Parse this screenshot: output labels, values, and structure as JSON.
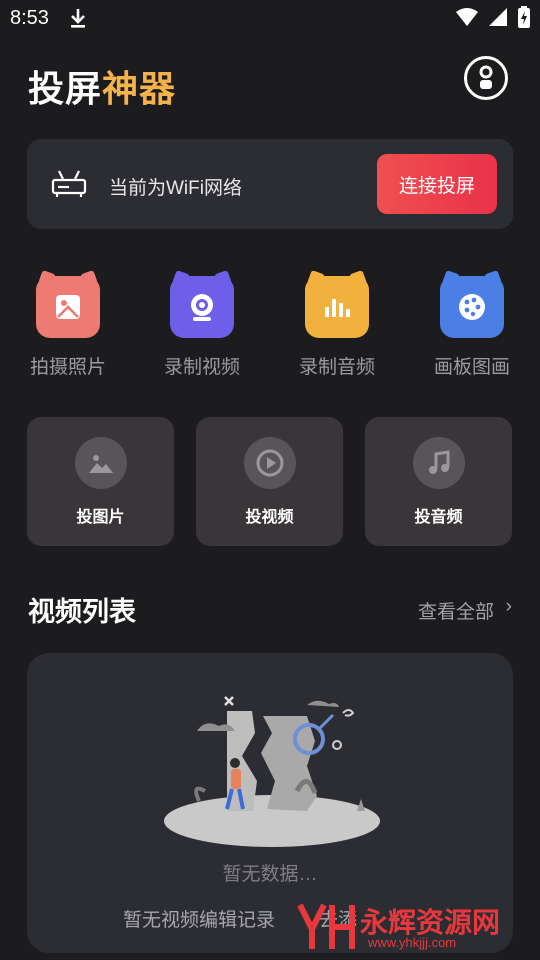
{
  "status_bar": {
    "time": "8:53"
  },
  "header": {
    "title_part1": "投屏",
    "title_part2": "神器"
  },
  "wifi_card": {
    "text": "当前为WiFi网络",
    "button_label": "连接投屏"
  },
  "tools": [
    {
      "label": "拍摄照片",
      "icon": "photo-icon",
      "color": "#ee7a74"
    },
    {
      "label": "录制视频",
      "icon": "camera-icon",
      "color": "#6f5fe8"
    },
    {
      "label": "录制音频",
      "icon": "audio-bars-icon",
      "color": "#f2b13c"
    },
    {
      "label": "画板图画",
      "icon": "palette-icon",
      "color": "#4c7fe6"
    }
  ],
  "cast_cards": [
    {
      "label": "投图片",
      "icon": "image-icon"
    },
    {
      "label": "投视频",
      "icon": "play-icon"
    },
    {
      "label": "投音频",
      "icon": "music-icon"
    }
  ],
  "video_list": {
    "title": "视频列表",
    "see_all": "查看全部",
    "see_all_arrow": "›",
    "empty_text": "暂无数据…",
    "empty_sub": "暂无视频编辑记录",
    "empty_sub_tail": "去添"
  },
  "watermark": {
    "brand": "永辉资源网",
    "url": "www.yhkjjj.com"
  }
}
